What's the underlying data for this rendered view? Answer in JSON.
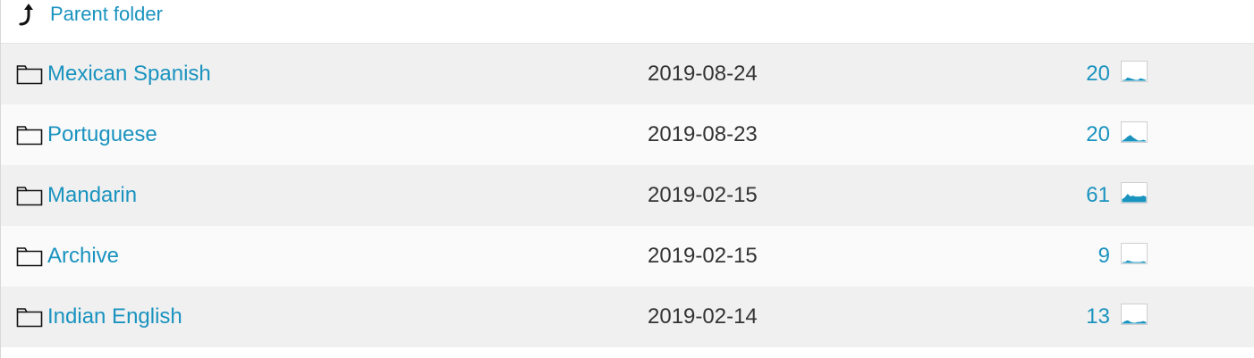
{
  "parent": {
    "label": "Parent folder",
    "icon": "arrow-up-icon"
  },
  "accent_color": "#1a93bf",
  "folders": [
    {
      "name": "Mexican Spanish",
      "date": "2019-08-24",
      "count": "20",
      "icon": "folder-icon",
      "activity": [
        0,
        0,
        0.15,
        0.1,
        0.05,
        0,
        0,
        0.1,
        0.05,
        0
      ]
    },
    {
      "name": "Portuguese",
      "date": "2019-08-23",
      "count": "20",
      "icon": "folder-icon",
      "activity": [
        0,
        0.1,
        0.25,
        0.35,
        0.2,
        0.1,
        0,
        0,
        0.05,
        0
      ]
    },
    {
      "name": "Mandarin",
      "date": "2019-02-15",
      "count": "61",
      "icon": "folder-icon",
      "activity": [
        0.15,
        0.25,
        0.45,
        0.3,
        0.35,
        0.3,
        0.3,
        0.3,
        0.35,
        0.3
      ]
    },
    {
      "name": "Archive",
      "date": "2019-02-15",
      "count": "9",
      "icon": "folder-icon",
      "activity": [
        0,
        0,
        0.1,
        0.05,
        0,
        0,
        0,
        0,
        0.05,
        0
      ]
    },
    {
      "name": "Indian English",
      "date": "2019-02-14",
      "count": "13",
      "icon": "folder-icon",
      "activity": [
        0,
        0.1,
        0.15,
        0.05,
        0,
        0,
        0.05,
        0.05,
        0.1,
        0.05
      ]
    }
  ]
}
